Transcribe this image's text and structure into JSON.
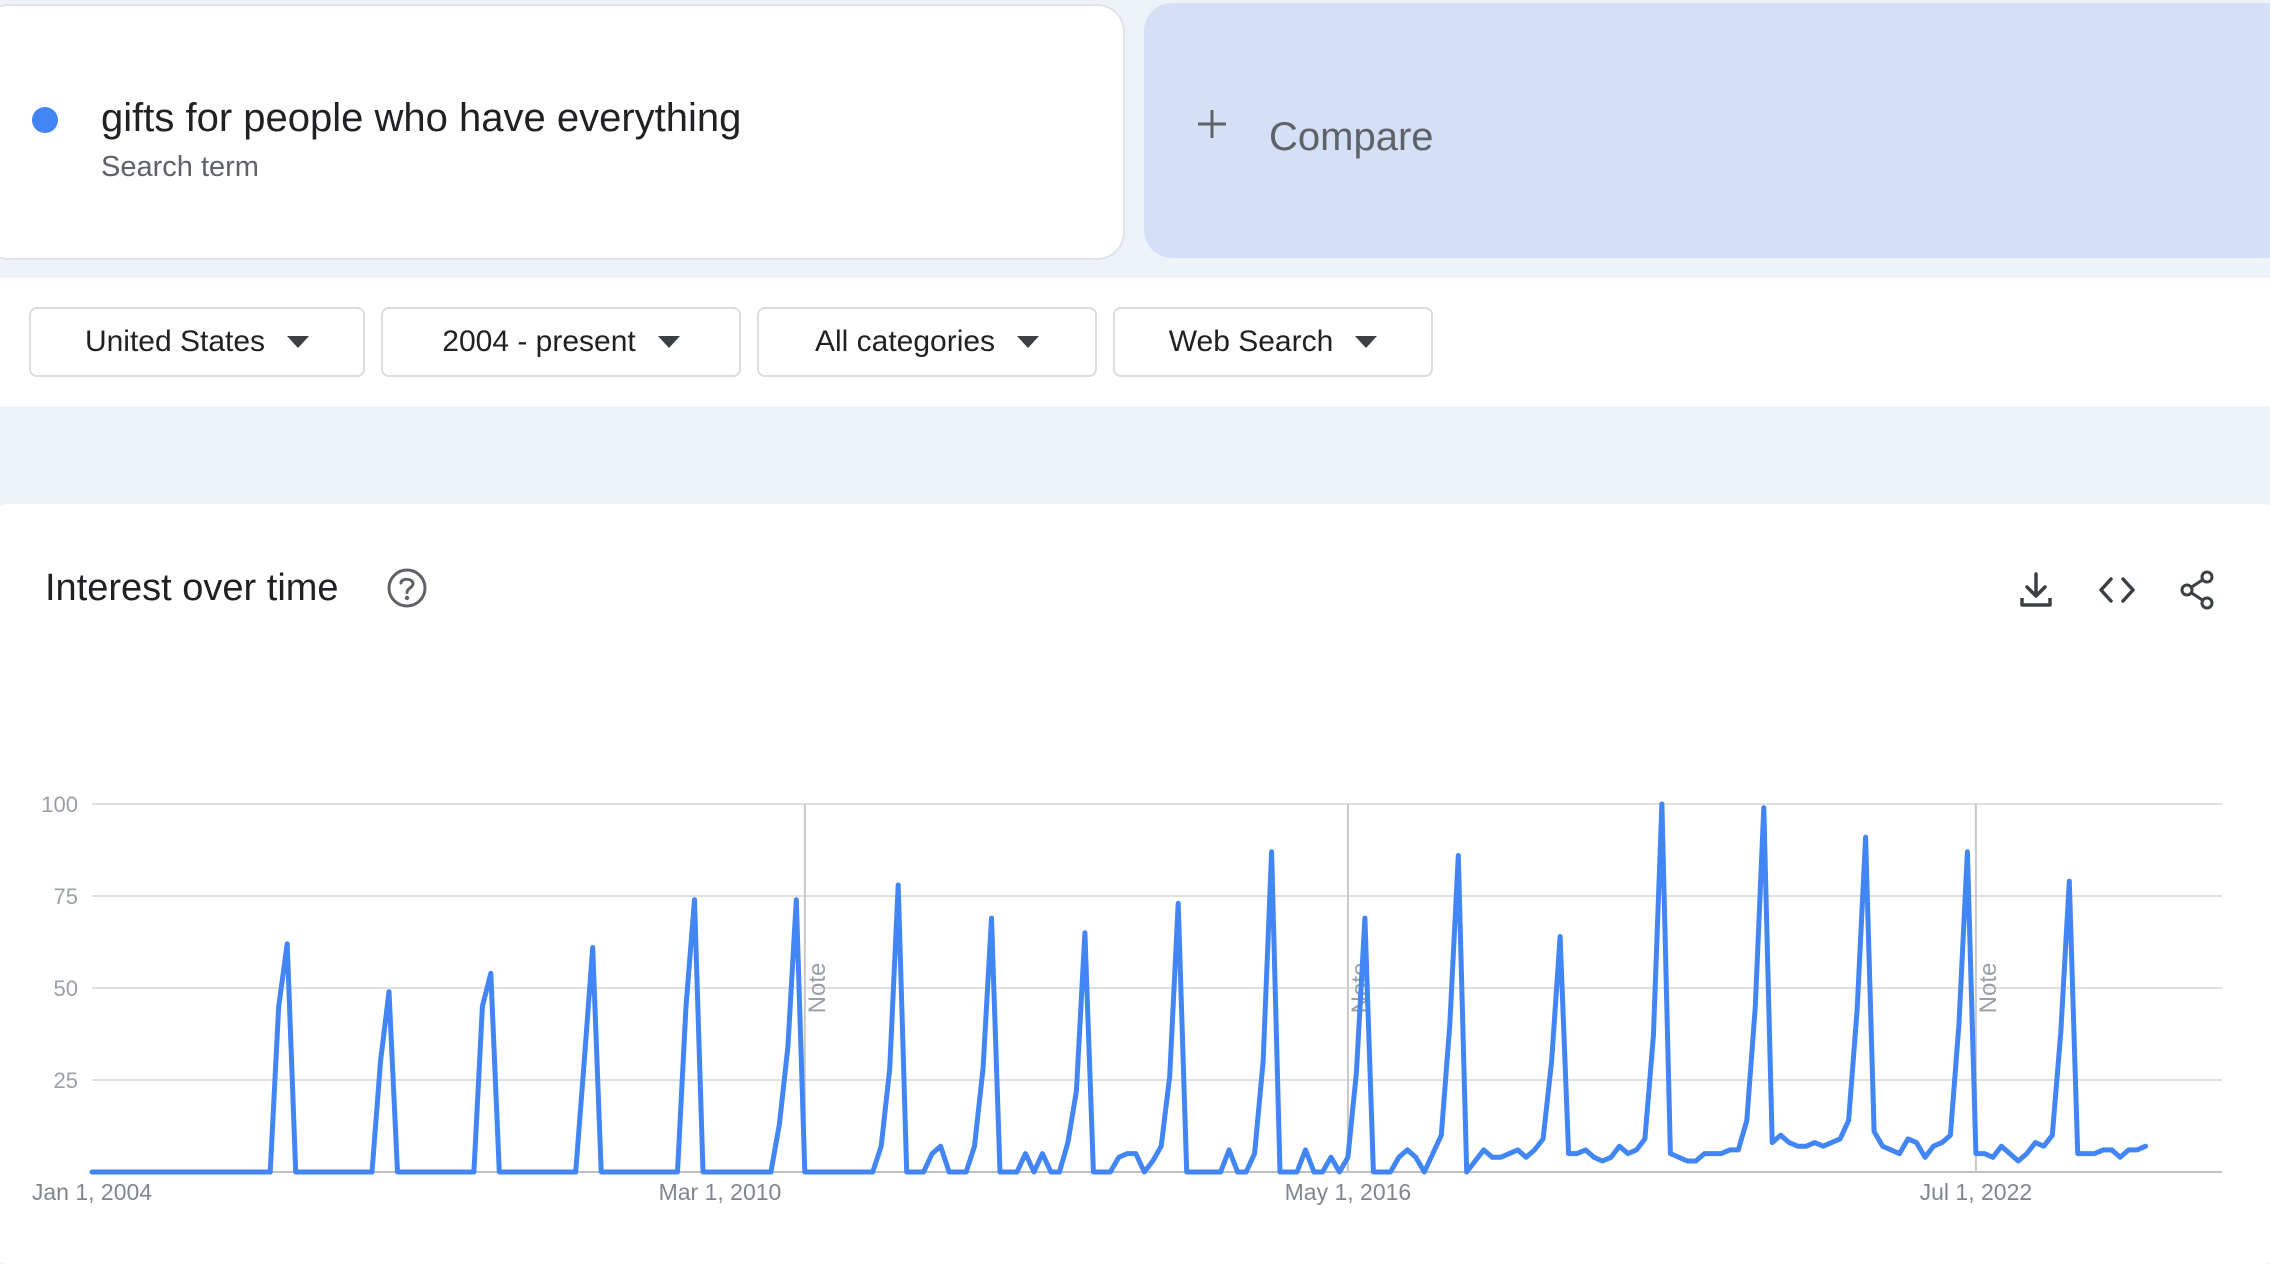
{
  "search_term": {
    "text": "gifts for people who have everything",
    "subtitle": "Search term",
    "color": "#4285f4"
  },
  "compare": {
    "label": "Compare",
    "icon": "plus-icon"
  },
  "filters": {
    "region": "United States",
    "time_range": "2004 - present",
    "category": "All categories",
    "search_type": "Web Search"
  },
  "section": {
    "title": "Interest over time",
    "icons": [
      "help-icon",
      "download-icon",
      "embed-code-icon",
      "share-icon"
    ]
  },
  "chart_data": {
    "type": "line",
    "title": "",
    "xlabel": "",
    "ylabel": "",
    "ylim": [
      0,
      100
    ],
    "yticks": [
      25,
      50,
      75,
      100
    ],
    "ytick_labels": [
      "25",
      "50",
      "75",
      "100"
    ],
    "xlim": [
      "2004-01",
      "2024-12"
    ],
    "xticks": [
      {
        "x": "2004-01",
        "label": "Jan 1, 2004"
      },
      {
        "x": "2010-03",
        "label": "Mar 1, 2010"
      },
      {
        "x": "2016-05",
        "label": "May 1, 2016"
      },
      {
        "x": "2022-07",
        "label": "Jul 1, 2022"
      }
    ],
    "notes": [
      {
        "x": "2011-01",
        "label": "Note"
      },
      {
        "x": "2016-05",
        "label": "Note"
      },
      {
        "x": "2022-07",
        "label": "Note"
      }
    ],
    "grid": true,
    "color": "#4285f4",
    "series": [
      {
        "name": "gifts for people who have everything",
        "points": [
          [
            "2004-01",
            0
          ],
          [
            "2005-10",
            0
          ],
          [
            "2005-11",
            45
          ],
          [
            "2005-12",
            62
          ],
          [
            "2006-01",
            0
          ],
          [
            "2006-10",
            0
          ],
          [
            "2006-11",
            30
          ],
          [
            "2006-12",
            49
          ],
          [
            "2007-01",
            0
          ],
          [
            "2007-10",
            0
          ],
          [
            "2007-11",
            45
          ],
          [
            "2007-12",
            54
          ],
          [
            "2008-01",
            0
          ],
          [
            "2008-10",
            0
          ],
          [
            "2008-11",
            30
          ],
          [
            "2008-12",
            61
          ],
          [
            "2009-01",
            0
          ],
          [
            "2009-10",
            0
          ],
          [
            "2009-11",
            45
          ],
          [
            "2009-12",
            74
          ],
          [
            "2010-01",
            0
          ],
          [
            "2010-09",
            0
          ],
          [
            "2010-10",
            13
          ],
          [
            "2010-11",
            34
          ],
          [
            "2010-12",
            74
          ],
          [
            "2011-01",
            0
          ],
          [
            "2011-09",
            0
          ],
          [
            "2011-10",
            7
          ],
          [
            "2011-11",
            28
          ],
          [
            "2011-12",
            78
          ],
          [
            "2012-01",
            0
          ],
          [
            "2012-03",
            0
          ],
          [
            "2012-04",
            5
          ],
          [
            "2012-05",
            7
          ],
          [
            "2012-06",
            0
          ],
          [
            "2012-08",
            0
          ],
          [
            "2012-09",
            7
          ],
          [
            "2012-10",
            28
          ],
          [
            "2012-11",
            69
          ],
          [
            "2012-12",
            0
          ],
          [
            "2013-02",
            0
          ],
          [
            "2013-03",
            5
          ],
          [
            "2013-04",
            0
          ],
          [
            "2013-05",
            5
          ],
          [
            "2013-06",
            0
          ],
          [
            "2013-07",
            0
          ],
          [
            "2013-08",
            8
          ],
          [
            "2013-09",
            22
          ],
          [
            "2013-10",
            65
          ],
          [
            "2013-11",
            0
          ],
          [
            "2014-01",
            0
          ],
          [
            "2014-02",
            4
          ],
          [
            "2014-03",
            5
          ],
          [
            "2014-04",
            5
          ],
          [
            "2014-05",
            0
          ],
          [
            "2014-06",
            3
          ],
          [
            "2014-07",
            7
          ],
          [
            "2014-08",
            26
          ],
          [
            "2014-09",
            73
          ],
          [
            "2014-10",
            0
          ],
          [
            "2015-02",
            0
          ],
          [
            "2015-03",
            6
          ],
          [
            "2015-04",
            0
          ],
          [
            "2015-05",
            0
          ],
          [
            "2015-06",
            5
          ],
          [
            "2015-07",
            30
          ],
          [
            "2015-08",
            87
          ],
          [
            "2015-09",
            0
          ],
          [
            "2015-11",
            0
          ],
          [
            "2015-12",
            6
          ],
          [
            "2016-01",
            0
          ],
          [
            "2016-02",
            0
          ],
          [
            "2016-03",
            4
          ],
          [
            "2016-04",
            0
          ],
          [
            "2016-05",
            4
          ],
          [
            "2016-06",
            27
          ],
          [
            "2016-07",
            69
          ],
          [
            "2016-08",
            0
          ],
          [
            "2016-10",
            0
          ],
          [
            "2016-11",
            4
          ],
          [
            "2016-12",
            6
          ],
          [
            "2017-01",
            4
          ],
          [
            "2017-02",
            0
          ],
          [
            "2017-04",
            10
          ],
          [
            "2017-05",
            40
          ],
          [
            "2017-06",
            86
          ],
          [
            "2017-07",
            0
          ],
          [
            "2017-08",
            3
          ],
          [
            "2017-09",
            6
          ],
          [
            "2017-10",
            4
          ],
          [
            "2017-11",
            4
          ],
          [
            "2017-12",
            5
          ],
          [
            "2018-01",
            6
          ],
          [
            "2018-02",
            4
          ],
          [
            "2018-03",
            6
          ],
          [
            "2018-04",
            9
          ],
          [
            "2018-05",
            30
          ],
          [
            "2018-06",
            64
          ],
          [
            "2018-07",
            5
          ],
          [
            "2018-08",
            5
          ],
          [
            "2018-09",
            6
          ],
          [
            "2018-10",
            4
          ],
          [
            "2018-11",
            3
          ],
          [
            "2018-12",
            4
          ],
          [
            "2019-01",
            7
          ],
          [
            "2019-02",
            5
          ],
          [
            "2019-03",
            6
          ],
          [
            "2019-04",
            9
          ],
          [
            "2019-05",
            37
          ],
          [
            "2019-06",
            100
          ],
          [
            "2019-07",
            5
          ],
          [
            "2019-08",
            4
          ],
          [
            "2019-09",
            3
          ],
          [
            "2019-10",
            3
          ],
          [
            "2019-11",
            5
          ],
          [
            "2019-12",
            5
          ],
          [
            "2020-01",
            5
          ],
          [
            "2020-02",
            6
          ],
          [
            "2020-03",
            6
          ],
          [
            "2020-04",
            14
          ],
          [
            "2020-05",
            45
          ],
          [
            "2020-06",
            99
          ],
          [
            "2020-07",
            8
          ],
          [
            "2020-08",
            10
          ],
          [
            "2020-09",
            8
          ],
          [
            "2020-10",
            7
          ],
          [
            "2020-11",
            7
          ],
          [
            "2020-12",
            8
          ],
          [
            "2021-01",
            7
          ],
          [
            "2021-02",
            8
          ],
          [
            "2021-03",
            9
          ],
          [
            "2021-04",
            14
          ],
          [
            "2021-05",
            44
          ],
          [
            "2021-06",
            91
          ],
          [
            "2021-07",
            11
          ],
          [
            "2021-08",
            7
          ],
          [
            "2021-09",
            6
          ],
          [
            "2021-10",
            5
          ],
          [
            "2021-11",
            9
          ],
          [
            "2021-12",
            8
          ],
          [
            "2022-01",
            4
          ],
          [
            "2022-02",
            7
          ],
          [
            "2022-03",
            8
          ],
          [
            "2022-04",
            10
          ],
          [
            "2022-05",
            40
          ],
          [
            "2022-06",
            87
          ],
          [
            "2022-07",
            5
          ],
          [
            "2022-08",
            5
          ],
          [
            "2022-09",
            4
          ],
          [
            "2022-10",
            7
          ],
          [
            "2022-11",
            5
          ],
          [
            "2022-12",
            3
          ],
          [
            "2023-01",
            5
          ],
          [
            "2023-02",
            8
          ],
          [
            "2023-03",
            7
          ],
          [
            "2023-04",
            10
          ],
          [
            "2023-05",
            38
          ],
          [
            "2023-06",
            79
          ],
          [
            "2023-07",
            5
          ],
          [
            "2023-08",
            5
          ],
          [
            "2023-09",
            5
          ],
          [
            "2023-10",
            6
          ],
          [
            "2023-11",
            6
          ],
          [
            "2023-12",
            4
          ],
          [
            "2024-01",
            6
          ],
          [
            "2024-02",
            6
          ],
          [
            "2024-03",
            7
          ]
        ]
      }
    ]
  }
}
